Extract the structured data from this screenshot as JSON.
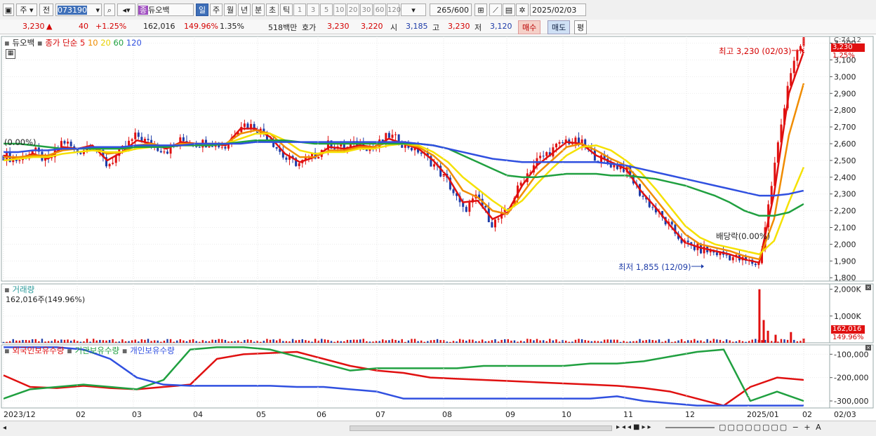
{
  "toolbar": {
    "market_label": "주",
    "period_label": "전",
    "code": "073190",
    "stock_badge": "종",
    "stock_name": "듀오백",
    "tf_buttons": [
      "일",
      "주",
      "월",
      "년",
      "분",
      "초",
      "틱"
    ],
    "min_buttons": [
      "1",
      "3",
      "5",
      "10",
      "20",
      "30",
      "60",
      "120"
    ],
    "count": "265",
    "count_total": "/600",
    "date": "2025/02/03"
  },
  "info": {
    "price": "3,230",
    "change": "40",
    "change_pct": "+1.25%",
    "volume": "162,016",
    "volume_ratio": "149.96%",
    "turnover": "1.35%",
    "amount": "518백만",
    "quote_label": "호가",
    "ask": "3,230",
    "bid": "3,220",
    "open_label": "시",
    "open": "3,185",
    "high_label": "고",
    "high": "3,230",
    "low_label": "저",
    "low": "3,120",
    "buy_label": "매수",
    "sell_label": "매도",
    "eval_label": "평"
  },
  "price_panel": {
    "legend_name": "듀오백",
    "legend_ma": "종가 단순",
    "ma_periods": [
      "5",
      "10",
      "20",
      "60",
      "120"
    ],
    "ma_colors": [
      "#e01010",
      "#f08c00",
      "#f5e100",
      "#20a040",
      "#3050e0"
    ],
    "corner_text": "C:74.12",
    "last_price_tag": "3,230",
    "last_pct_tag": "1.25%",
    "high_annotation": "최고 3,230 (02/03)",
    "low_annotation": "최저 1,855 (12/09)",
    "dividend_annotation": "배당락(0.00%)",
    "left_annotation": "(0.00%)"
  },
  "volume_panel": {
    "title": "거래량",
    "value_text": "162,016주(149.96%)",
    "last_tag": "162,016",
    "pct_tag": "149.96%"
  },
  "holding_panel": {
    "legend": [
      "외국인보유수량",
      "기관보유수량",
      "개인보유수량"
    ]
  },
  "x_labels": [
    "2023/12",
    "02",
    "03",
    "04",
    "05",
    "06",
    "07",
    "08",
    "09",
    "10",
    "11",
    "12",
    "2025/01",
    "02"
  ],
  "right_x_label": "02/03",
  "chart_data": [
    {
      "type": "line",
      "title": "듀오백",
      "ylim": [
        1750,
        3250
      ],
      "yticks": [
        1800,
        1900,
        2000,
        2100,
        2200,
        2300,
        2400,
        2500,
        2600,
        2700,
        2800,
        2900,
        3000,
        3100,
        3200
      ],
      "x": [
        "2023/12",
        "02",
        "03",
        "04",
        "05",
        "06",
        "07",
        "08",
        "09",
        "10",
        "11",
        "12",
        "2025/01",
        "02"
      ],
      "close_series": [
        2530,
        2500,
        2560,
        2490,
        2620,
        2550,
        2600,
        2470,
        2560,
        2650,
        2590,
        2560,
        2620,
        2600,
        2610,
        2580,
        2720,
        2700,
        2630,
        2510,
        2480,
        2530,
        2600,
        2570,
        2600,
        2570,
        2650,
        2600,
        2560,
        2480,
        2370,
        2200,
        2280,
        2120,
        2200,
        2380,
        2500,
        2560,
        2620,
        2600,
        2520,
        2480,
        2450,
        2300,
        2200,
        2100,
        2000,
        1970,
        1950,
        1930,
        1900,
        1880,
        2450,
        3000,
        3230
      ],
      "ma_series": [
        {
          "name": "5",
          "values": [
            2530,
            2510,
            2540,
            2510,
            2580,
            2570,
            2590,
            2500,
            2550,
            2620,
            2600,
            2570,
            2610,
            2600,
            2600,
            2590,
            2690,
            2690,
            2640,
            2540,
            2490,
            2520,
            2580,
            2570,
            2590,
            2580,
            2630,
            2600,
            2570,
            2500,
            2400,
            2250,
            2260,
            2150,
            2190,
            2350,
            2470,
            2540,
            2610,
            2600,
            2530,
            2490,
            2450,
            2320,
            2220,
            2110,
            2010,
            1980,
            1960,
            1940,
            1910,
            1890,
            2300,
            2900,
            3150
          ]
        },
        {
          "name": "10",
          "values": [
            2520,
            2520,
            2530,
            2530,
            2560,
            2570,
            2580,
            2540,
            2550,
            2590,
            2600,
            2580,
            2600,
            2600,
            2600,
            2600,
            2660,
            2680,
            2660,
            2580,
            2520,
            2520,
            2560,
            2560,
            2580,
            2580,
            2610,
            2600,
            2580,
            2530,
            2450,
            2320,
            2280,
            2200,
            2180,
            2300,
            2420,
            2500,
            2580,
            2600,
            2560,
            2510,
            2470,
            2380,
            2270,
            2160,
            2060,
            2000,
            1980,
            1960,
            1930,
            1910,
            2150,
            2650,
            2960
          ]
        },
        {
          "name": "20",
          "values": [
            2500,
            2510,
            2520,
            2520,
            2540,
            2550,
            2560,
            2550,
            2550,
            2570,
            2580,
            2580,
            2590,
            2590,
            2600,
            2600,
            2630,
            2660,
            2660,
            2620,
            2560,
            2540,
            2550,
            2550,
            2570,
            2570,
            2590,
            2600,
            2590,
            2550,
            2490,
            2400,
            2330,
            2260,
            2200,
            2260,
            2360,
            2450,
            2530,
            2580,
            2590,
            2560,
            2500,
            2430,
            2330,
            2220,
            2110,
            2040,
            2000,
            1980,
            1960,
            1940,
            2020,
            2250,
            2460
          ]
        },
        {
          "name": "60",
          "values": [
            2600,
            2600,
            2590,
            2580,
            2570,
            2570,
            2570,
            2570,
            2570,
            2580,
            2580,
            2580,
            2590,
            2590,
            2590,
            2600,
            2610,
            2620,
            2620,
            2620,
            2610,
            2600,
            2600,
            2600,
            2600,
            2600,
            2600,
            2600,
            2600,
            2590,
            2570,
            2530,
            2490,
            2450,
            2410,
            2400,
            2400,
            2410,
            2420,
            2420,
            2420,
            2410,
            2410,
            2400,
            2390,
            2370,
            2350,
            2320,
            2290,
            2250,
            2200,
            2170,
            2170,
            2190,
            2240
          ]
        },
        {
          "name": "120",
          "values": [
            2550,
            2550,
            2560,
            2560,
            2570,
            2570,
            2580,
            2580,
            2580,
            2590,
            2590,
            2590,
            2590,
            2600,
            2600,
            2600,
            2600,
            2610,
            2610,
            2610,
            2610,
            2610,
            2610,
            2610,
            2610,
            2610,
            2610,
            2610,
            2600,
            2590,
            2570,
            2550,
            2530,
            2510,
            2500,
            2490,
            2490,
            2490,
            2490,
            2490,
            2490,
            2480,
            2470,
            2450,
            2430,
            2410,
            2390,
            2370,
            2350,
            2330,
            2310,
            2290,
            2290,
            2300,
            2320
          ]
        }
      ]
    },
    {
      "type": "bar",
      "title": "거래량",
      "ylim": [
        0,
        2200000
      ],
      "yticks": [
        1000000,
        2000000
      ],
      "ytick_labels": [
        "1,000K",
        "2,000K"
      ],
      "spikes": [
        {
          "x": 0.888,
          "value": 2000000
        },
        {
          "x": 0.893,
          "value": 850000
        },
        {
          "x": 0.898,
          "value": 450000
        },
        {
          "x": 0.907,
          "value": 300000
        },
        {
          "x": 0.925,
          "value": 400000
        },
        {
          "x": 0.94,
          "value": 162016
        }
      ]
    },
    {
      "type": "line",
      "title": "보유수량",
      "ylim": [
        -330000,
        -60000
      ],
      "yticks": [
        -100000,
        -200000,
        -300000
      ],
      "ytick_labels": [
        "-100,000",
        "-200,000",
        "-300,000"
      ],
      "series": [
        {
          "name": "외국인보유수량",
          "color": "#e01010",
          "values": [
            -190000,
            -240000,
            -245000,
            -235000,
            -245000,
            -250000,
            -240000,
            -230000,
            -120000,
            -100000,
            -95000,
            -90000,
            -120000,
            -150000,
            -170000,
            -180000,
            -200000,
            -205000,
            -210000,
            -215000,
            -220000,
            -225000,
            -230000,
            -235000,
            -245000,
            -260000,
            -290000,
            -320000,
            -240000,
            -200000,
            -210000
          ]
        },
        {
          "name": "기관보유수량",
          "color": "#20a040",
          "values": [
            -290000,
            -250000,
            -240000,
            -230000,
            -240000,
            -250000,
            -210000,
            -80000,
            -70000,
            -70000,
            -80000,
            -110000,
            -140000,
            -170000,
            -160000,
            -160000,
            -160000,
            -160000,
            -150000,
            -150000,
            -150000,
            -150000,
            -140000,
            -140000,
            -130000,
            -110000,
            -90000,
            -80000,
            -300000,
            -260000,
            -300000
          ]
        },
        {
          "name": "개인보유수량",
          "color": "#3050e0",
          "values": [
            -70000,
            -70000,
            -70000,
            -80000,
            -120000,
            -200000,
            -230000,
            -235000,
            -235000,
            -235000,
            -235000,
            -240000,
            -240000,
            -250000,
            -260000,
            -290000,
            -290000,
            -290000,
            -290000,
            -290000,
            -290000,
            -290000,
            -290000,
            -280000,
            -300000,
            -310000,
            -320000,
            -320000,
            -320000,
            -320000,
            -320000
          ]
        }
      ]
    }
  ]
}
